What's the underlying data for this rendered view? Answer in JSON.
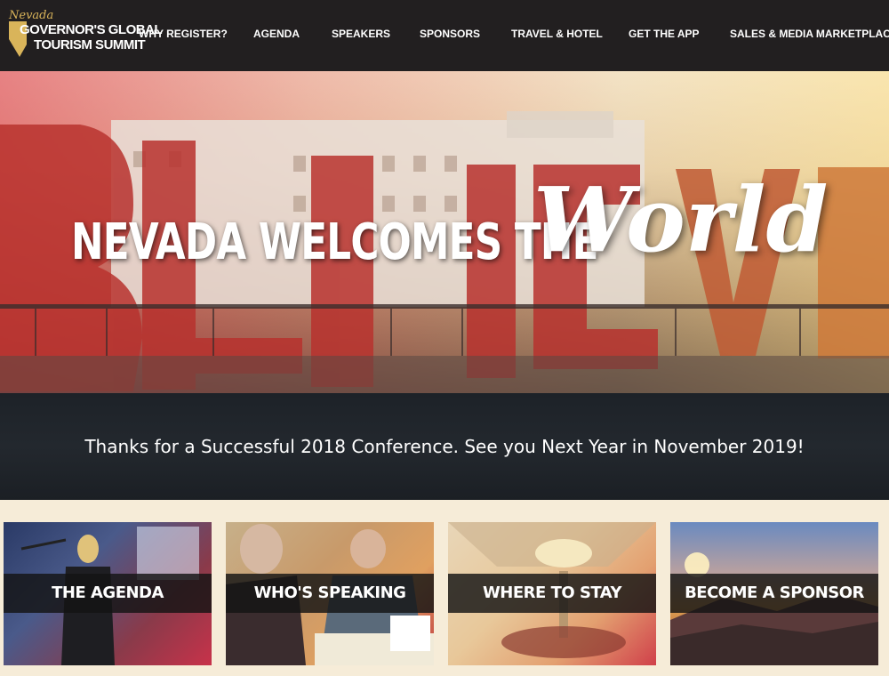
{
  "logo": {
    "script_word": "Nevada",
    "line1": "GOVERNOR'S GLOBAL",
    "line2": "TOURISM SUMMIT"
  },
  "nav": {
    "items": [
      {
        "label": "WHY REGISTER?"
      },
      {
        "label": "AGENDA"
      },
      {
        "label": "SPEAKERS"
      },
      {
        "label": "SPONSORS"
      },
      {
        "label": "TRAVEL & HOTEL"
      },
      {
        "label": "GET THE APP"
      },
      {
        "label": "SALES & MEDIA MARKETPLACES"
      }
    ]
  },
  "hero": {
    "headline": "NEVADA WELCOMES THE",
    "script": "World"
  },
  "banner": {
    "text": "Thanks for a Successful 2018 Conference. See you Next Year in November 2019!"
  },
  "cards": [
    {
      "label": "THE AGENDA"
    },
    {
      "label": "WHO'S SPEAKING"
    },
    {
      "label": "WHERE TO STAY"
    },
    {
      "label": "BECOME A SPONSOR"
    }
  ],
  "colors": {
    "nav_bg": "#221f20",
    "accent_gold": "#d9b45a",
    "page_bg": "#f6ecd8",
    "banner_bg": "#1d2228"
  }
}
